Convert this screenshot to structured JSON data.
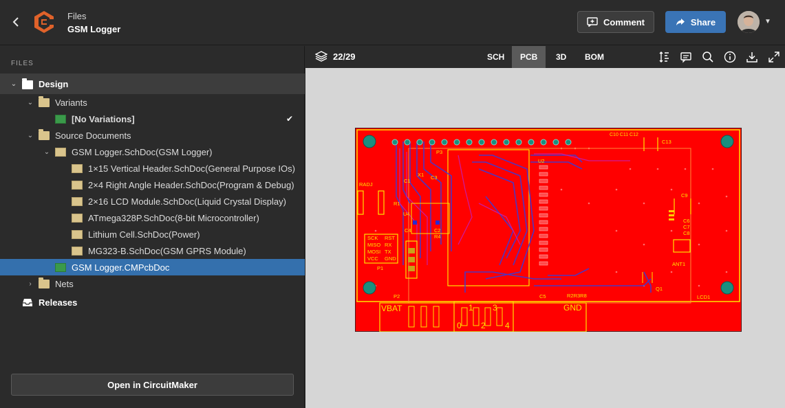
{
  "header": {
    "crumb": "Files",
    "title": "GSM Logger",
    "comment_label": "Comment",
    "share_label": "Share"
  },
  "sidebar": {
    "section_label": "FILES",
    "open_button": "Open in CircuitMaker",
    "tree": [
      {
        "label": "Design",
        "level": 0,
        "type": "folder-white",
        "expanded": true
      },
      {
        "label": "Variants",
        "level": 1,
        "type": "folder",
        "expanded": true
      },
      {
        "label": "[No Variations]",
        "level": 2,
        "type": "pcb",
        "checked": true
      },
      {
        "label": "Source Documents",
        "level": 1,
        "type": "folder",
        "expanded": true
      },
      {
        "label": "GSM Logger.SchDoc(GSM Logger)",
        "level": 2,
        "type": "doc",
        "expanded": true
      },
      {
        "label": "1×15 Vertical Header.SchDoc(General Purpose IOs)",
        "level": 3,
        "type": "doc"
      },
      {
        "label": "2×4 Right Angle Header.SchDoc(Program & Debug)",
        "level": 3,
        "type": "doc"
      },
      {
        "label": "2×16 LCD Module.SchDoc(Liquid Crystal Display)",
        "level": 3,
        "type": "doc"
      },
      {
        "label": "ATmega328P.SchDoc(8-bit Microcontroller)",
        "level": 3,
        "type": "doc"
      },
      {
        "label": "Lithium Cell.SchDoc(Power)",
        "level": 3,
        "type": "doc"
      },
      {
        "label": "MG323-B.SchDoc(GSM GPRS Module)",
        "level": 3,
        "type": "doc"
      },
      {
        "label": "GSM Logger.CMPcbDoc",
        "level": 2,
        "type": "pcb",
        "selected": true
      },
      {
        "label": "Nets",
        "level": 1,
        "type": "folder",
        "expanded": false
      },
      {
        "label": "Releases",
        "level": 0,
        "type": "releases"
      }
    ]
  },
  "viewer": {
    "layer_count": "22/29",
    "tabs": [
      {
        "label": "SCH",
        "active": false
      },
      {
        "label": "PCB",
        "active": true
      },
      {
        "label": "3D",
        "active": false
      },
      {
        "label": "BOM",
        "active": false
      }
    ],
    "board": {
      "labels": {
        "vbat": "VBAT",
        "gnd": "GND",
        "n1": "1",
        "n3": "3",
        "n0": "0",
        "n2": "2",
        "n4": "4",
        "p1": "P1",
        "p2": "P2",
        "p3": "P3",
        "u2": "U2",
        "u4": "U4",
        "radj": "RADJ",
        "r1": "R1",
        "c1": "C1",
        "c3": "C3",
        "x1": "X1",
        "c2": "C2",
        "c4": "C4",
        "r4": "R4",
        "c13": "C13",
        "c9": "C9",
        "c6": "C6",
        "c7": "C7",
        "c8": "C8",
        "ant1": "ANT1",
        "q1": "Q1",
        "lcd1": "LCD1",
        "c5": "C5",
        "r2r3r8": "R2R3R8",
        "top_caps": "C10 C11 C12",
        "sck": "SCK",
        "rst": "RST",
        "miso": "MISO",
        "rx": "RX",
        "mosi": "MOSI",
        "tx": "TX",
        "vcc": "VCC",
        "gndp": "GND"
      }
    }
  },
  "colors": {
    "board_red": "#ff0000",
    "silk_yellow": "#ffe400",
    "trace_blue": "#3b3bd6",
    "pad_teal": "#1a8f7f",
    "accent_blue": "#3470ad"
  }
}
